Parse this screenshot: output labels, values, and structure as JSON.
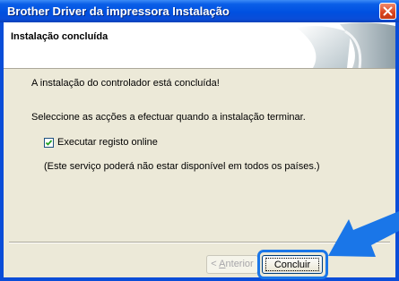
{
  "window": {
    "title": "Brother Driver da impressora Instalação"
  },
  "header": {
    "title": "Instalação concluída"
  },
  "body": {
    "message": "A instalação do controlador está concluída!",
    "instruction": "Seleccione as acções a efectuar quando a instalação terminar.",
    "checkbox": {
      "label": "Executar registo online",
      "checked": true
    },
    "note": "(Este serviço poderá não estar disponível em todos os países.)"
  },
  "buttons": {
    "back": {
      "prefix": "< ",
      "mnemonic": "A",
      "rest": "nterior",
      "enabled": false
    },
    "finish": {
      "label": "Concluir"
    }
  },
  "colors": {
    "titlebar": "#0a4dd8",
    "callout": "#1a76e8",
    "dialog_bg": "#ece9d8"
  },
  "icons": {
    "close": "close-icon",
    "checkmark": "checkmark-icon",
    "callout": "callout-arrow-icon"
  }
}
